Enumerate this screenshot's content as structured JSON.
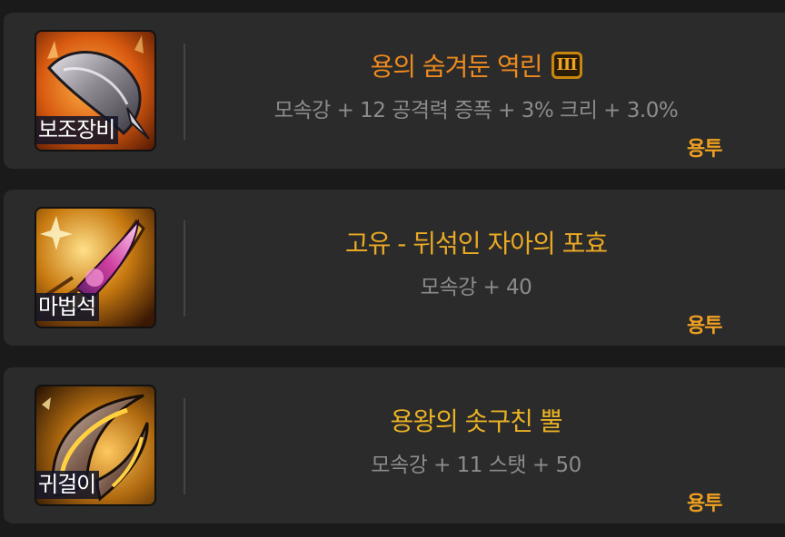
{
  "colors": {
    "background": "#1a1a1a",
    "card": "#2b2b2b",
    "title_orange": "#ee8a1f",
    "title_gold": "#e9b124",
    "stats_gray": "#8c8c8c",
    "source_gold": "#f0a020"
  },
  "items": [
    {
      "slot": "보조장비",
      "icon": "secondary-weapon-icon",
      "title": "용의 숨겨둔 역린",
      "title_color": "#ee8a1f",
      "tier": "III",
      "stats": "모속강 + 12 공격력 증폭 + 3% 크리 + 3.0%",
      "source": "용투"
    },
    {
      "slot": "마법석",
      "icon": "magic-stone-icon",
      "title": "고유 - 뒤섞인 자아의 포효",
      "title_color": "#e9a924",
      "tier": "",
      "stats": "모속강 + 40",
      "source": "용투"
    },
    {
      "slot": "귀걸이",
      "icon": "earring-icon",
      "title": "용왕의 솟구친 뿔",
      "title_color": "#e9b124",
      "tier": "",
      "stats": "모속강 + 11 스탯 + 50",
      "source": "용투"
    }
  ]
}
